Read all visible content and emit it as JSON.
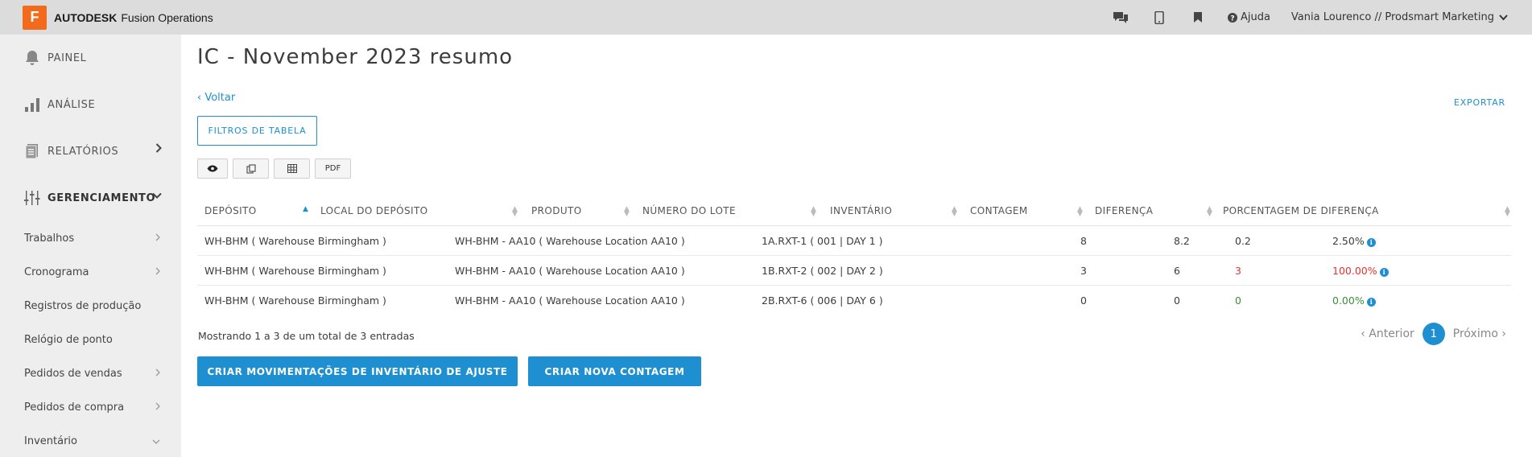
{
  "topbar": {
    "logo_letter": "F",
    "brand": "AUTODESK",
    "product": "Fusion Operations",
    "help": "Ajuda",
    "user": "Vania Lourenco // Prodsmart Marketing"
  },
  "sidebar": {
    "main": [
      {
        "label": "PAINEL",
        "icon": "bell-icon"
      },
      {
        "label": "ANÁLISE",
        "icon": "bar-chart-icon"
      },
      {
        "label": "RELATÓRIOS",
        "icon": "document-icon"
      },
      {
        "label": "GERENCIAMENTO",
        "icon": "sliders-icon"
      }
    ],
    "sub": [
      {
        "label": "Trabalhos"
      },
      {
        "label": "Cronograma"
      },
      {
        "label": "Registros de produção"
      },
      {
        "label": "Relógio de ponto"
      },
      {
        "label": "Pedidos de vendas"
      },
      {
        "label": "Pedidos de compra"
      },
      {
        "label": "Inventário"
      }
    ]
  },
  "main": {
    "title": "IC - November 2023 resumo",
    "back": "‹ Voltar",
    "export": "EXPORTAR",
    "filters": "FILTROS DE TABELA",
    "pdf": "PDF"
  },
  "table": {
    "headers": [
      "DEPÓSITO",
      "LOCAL DO DEPÓSITO",
      "PRODUTO",
      "NÚMERO DO LOTE",
      "INVENTÁRIO",
      "CONTAGEM",
      "DIFERENÇA",
      "PORCENTAGEM DE DIFERENÇA"
    ],
    "rows": [
      [
        "WH-BHM ( Warehouse Birmingham )",
        "WH-BHM - AA10 ( Warehouse Location AA10 )",
        "1A.RXT-1 ( 001 | DAY 1 )",
        "8",
        "8.2",
        "0.2",
        "2.50%"
      ],
      [
        "WH-BHM ( Warehouse Birmingham )",
        "WH-BHM - AA10 ( Warehouse Location AA10 )",
        "1B.RXT-2 ( 002 | DAY 2 )",
        "3",
        "6",
        "3",
        "100.00%"
      ],
      [
        "WH-BHM ( Warehouse Birmingham )",
        "WH-BHM - AA10 ( Warehouse Location AA10 )",
        "2B.RXT-6 ( 006 | DAY 6 )",
        "0",
        "0",
        "0",
        "0.00%"
      ]
    ]
  },
  "footer": {
    "summary": "Mostrando 1 a 3 de um total de 3 entradas",
    "prev": "‹ Anterior",
    "page": "1",
    "next": "Próximo ›",
    "btn_adjust": "CRIAR MOVIMENTAÇÕES DE INVENTÁRIO DE AJUSTE",
    "btn_count": "CRIAR NOVA CONTAGEM"
  },
  "colors": {
    "accent": "#1e8fd0",
    "logo": "#f26b1d",
    "negative": "#e5322d",
    "positive": "#3b8e3b"
  }
}
